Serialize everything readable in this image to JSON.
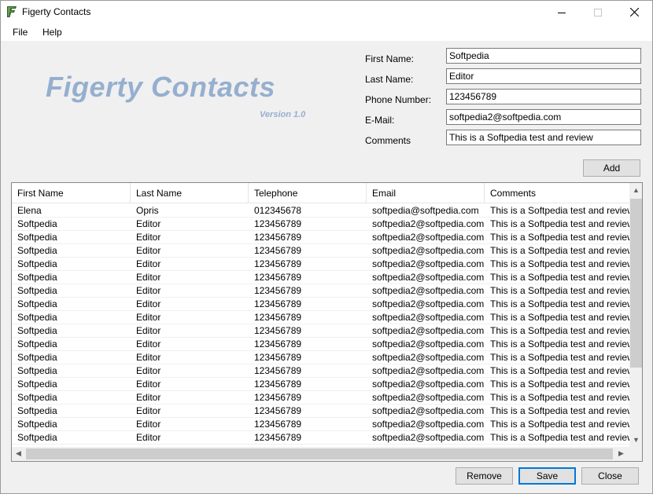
{
  "window": {
    "title": "Figerty Contacts"
  },
  "menu": {
    "file": "File",
    "help": "Help"
  },
  "logo": {
    "title": "Figerty Contacts",
    "version": "Version 1.0"
  },
  "form": {
    "first_name": {
      "label": "First Name:",
      "value": "Softpedia"
    },
    "last_name": {
      "label": "Last Name:",
      "value": "Editor"
    },
    "phone": {
      "label": "Phone Number:",
      "value": "123456789"
    },
    "email": {
      "label": "E-Mail:",
      "value": "softpedia2@softpedia.com"
    },
    "comments": {
      "label": "Comments",
      "value": "This is a Softpedia test and review"
    }
  },
  "buttons": {
    "add": "Add",
    "remove": "Remove",
    "save": "Save",
    "close": "Close"
  },
  "grid": {
    "columns": [
      "First Name",
      "Last Name",
      "Telephone",
      "Email",
      "Comments"
    ],
    "rows": [
      [
        "Elena",
        "Opris",
        "012345678",
        "softpedia@softpedia.com",
        "This is a Softpedia test and review"
      ],
      [
        "Softpedia",
        "Editor",
        "123456789",
        "softpedia2@softpedia.com",
        "This is a Softpedia test and review"
      ],
      [
        "Softpedia",
        "Editor",
        "123456789",
        "softpedia2@softpedia.com",
        "This is a Softpedia test and review"
      ],
      [
        "Softpedia",
        "Editor",
        "123456789",
        "softpedia2@softpedia.com",
        "This is a Softpedia test and review"
      ],
      [
        "Softpedia",
        "Editor",
        "123456789",
        "softpedia2@softpedia.com",
        "This is a Softpedia test and review"
      ],
      [
        "Softpedia",
        "Editor",
        "123456789",
        "softpedia2@softpedia.com",
        "This is a Softpedia test and review"
      ],
      [
        "Softpedia",
        "Editor",
        "123456789",
        "softpedia2@softpedia.com",
        "This is a Softpedia test and review"
      ],
      [
        "Softpedia",
        "Editor",
        "123456789",
        "softpedia2@softpedia.com",
        "This is a Softpedia test and review"
      ],
      [
        "Softpedia",
        "Editor",
        "123456789",
        "softpedia2@softpedia.com",
        "This is a Softpedia test and review"
      ],
      [
        "Softpedia",
        "Editor",
        "123456789",
        "softpedia2@softpedia.com",
        "This is a Softpedia test and review"
      ],
      [
        "Softpedia",
        "Editor",
        "123456789",
        "softpedia2@softpedia.com",
        "This is a Softpedia test and review"
      ],
      [
        "Softpedia",
        "Editor",
        "123456789",
        "softpedia2@softpedia.com",
        "This is a Softpedia test and review"
      ],
      [
        "Softpedia",
        "Editor",
        "123456789",
        "softpedia2@softpedia.com",
        "This is a Softpedia test and review"
      ],
      [
        "Softpedia",
        "Editor",
        "123456789",
        "softpedia2@softpedia.com",
        "This is a Softpedia test and review"
      ],
      [
        "Softpedia",
        "Editor",
        "123456789",
        "softpedia2@softpedia.com",
        "This is a Softpedia test and review"
      ],
      [
        "Softpedia",
        "Editor",
        "123456789",
        "softpedia2@softpedia.com",
        "This is a Softpedia test and review"
      ],
      [
        "Softpedia",
        "Editor",
        "123456789",
        "softpedia2@softpedia.com",
        "This is a Softpedia test and review"
      ],
      [
        "Softpedia",
        "Editor",
        "123456789",
        "softpedia2@softpedia.com",
        "This is a Softpedia test and review"
      ]
    ]
  },
  "colors": {
    "logo": "#96afcf",
    "default_button_border": "#0078d7",
    "scroll_thumb": "#cdcdcd"
  },
  "icons": {
    "app": "figerty-logo-icon",
    "minimize": "minimize-icon",
    "maximize": "maximize-icon",
    "close": "close-icon"
  }
}
